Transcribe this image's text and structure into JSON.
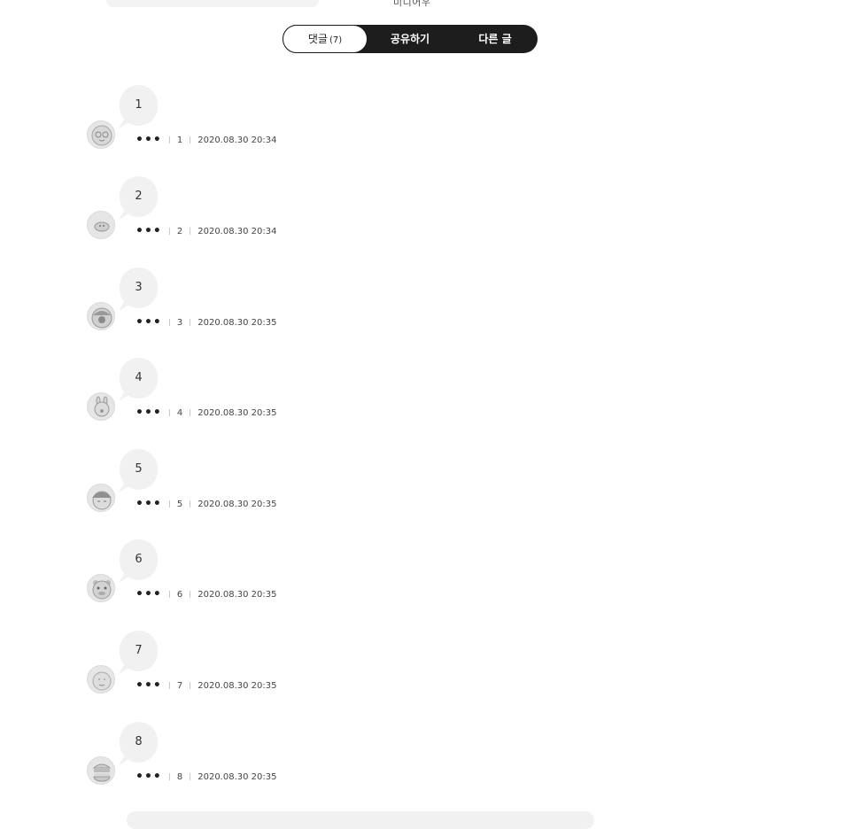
{
  "top_partial_text": "미디어우",
  "tabs": {
    "comments_label": "댓글",
    "comments_count": "(7)",
    "share_label": "공유하기",
    "other_label": "다른 글"
  },
  "more_icon_glyph": "•••",
  "comments": [
    {
      "text": "1",
      "author": "1",
      "date": "2020.08.30 20:34",
      "avatar": "character-avatar-icon"
    },
    {
      "text": "2",
      "author": "2",
      "date": "2020.08.30 20:34",
      "avatar": "character-avatar-icon"
    },
    {
      "text": "3",
      "author": "3",
      "date": "2020.08.30 20:35",
      "avatar": "character-avatar-icon"
    },
    {
      "text": "4",
      "author": "4",
      "date": "2020.08.30 20:35",
      "avatar": "character-avatar-icon"
    },
    {
      "text": "5",
      "author": "5",
      "date": "2020.08.30 20:35",
      "avatar": "character-avatar-icon"
    },
    {
      "text": "6",
      "author": "6",
      "date": "2020.08.30 20:35",
      "avatar": "character-avatar-icon"
    },
    {
      "text": "7",
      "author": "7",
      "date": "2020.08.30 20:35",
      "avatar": "character-avatar-icon"
    },
    {
      "text": "8",
      "author": "8",
      "date": "2020.08.30 20:35",
      "avatar": "character-avatar-icon"
    }
  ],
  "colors": {
    "tab_bar_bg": "#1d1d1d",
    "bubble_bg": "#f1f1f1",
    "avatar_bg": "#e6e6e6"
  }
}
